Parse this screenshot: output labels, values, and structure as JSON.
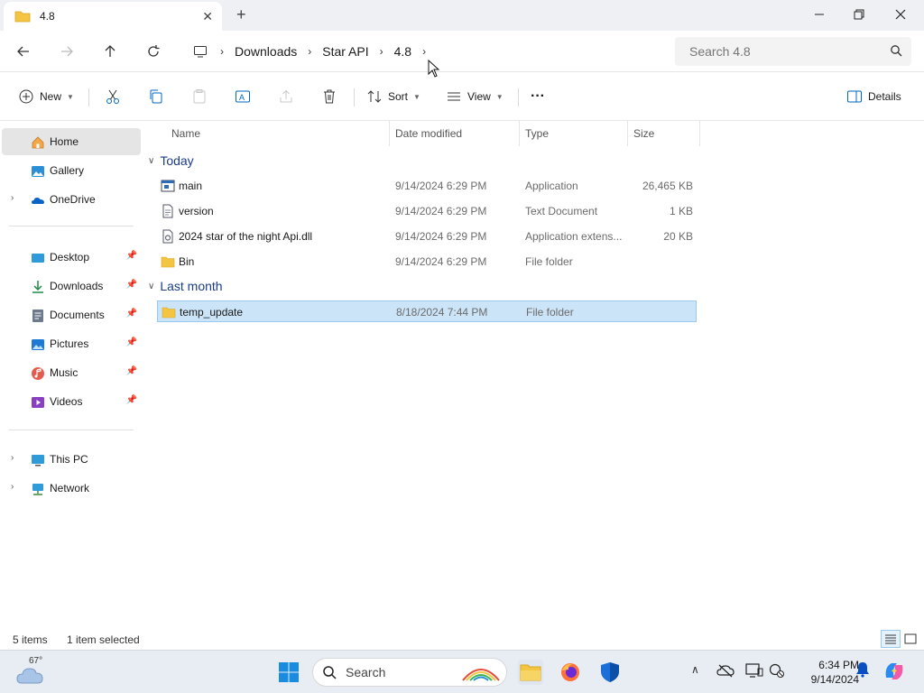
{
  "window": {
    "tab_title": "4.8",
    "new_tab": "+",
    "close_tab": "✕"
  },
  "address": {
    "crumbs": [
      "Downloads",
      "Star API",
      "4.8"
    ],
    "search_placeholder": "Search 4.8"
  },
  "commands": {
    "new": "New",
    "sort": "Sort",
    "view": "View",
    "more": "···",
    "details": "Details"
  },
  "sidebar": {
    "top": [
      {
        "label": "Home",
        "icon": "home-icon"
      },
      {
        "label": "Gallery",
        "icon": "gallery-icon"
      },
      {
        "label": "OneDrive",
        "icon": "onedrive-icon"
      }
    ],
    "quick": [
      {
        "label": "Desktop",
        "icon": "desktop-icon"
      },
      {
        "label": "Downloads",
        "icon": "downloads-icon"
      },
      {
        "label": "Documents",
        "icon": "documents-icon"
      },
      {
        "label": "Pictures",
        "icon": "pictures-icon"
      },
      {
        "label": "Music",
        "icon": "music-icon"
      },
      {
        "label": "Videos",
        "icon": "videos-icon"
      }
    ],
    "bottom": [
      {
        "label": "This PC",
        "icon": "this-pc-icon"
      },
      {
        "label": "Network",
        "icon": "network-icon"
      }
    ],
    "pin_glyph": "📌"
  },
  "columns": {
    "name": "Name",
    "date": "Date modified",
    "type": "Type",
    "size": "Size"
  },
  "groups": [
    {
      "label": "Today",
      "files": [
        {
          "name": "main",
          "date": "9/14/2024 6:29 PM",
          "type": "Application",
          "size": "26,465 KB",
          "icon": "application-icon"
        },
        {
          "name": "version",
          "date": "9/14/2024 6:29 PM",
          "type": "Text Document",
          "size": "1 KB",
          "icon": "text-document-icon"
        },
        {
          "name": "2024 star of the night Api.dll",
          "date": "9/14/2024 6:29 PM",
          "type": "Application extens...",
          "size": "20 KB",
          "icon": "dll-icon"
        },
        {
          "name": "Bin",
          "date": "9/14/2024 6:29 PM",
          "type": "File folder",
          "size": "",
          "icon": "folder-icon"
        }
      ]
    },
    {
      "label": "Last month",
      "files": [
        {
          "name": "temp_update",
          "date": "8/18/2024 7:44 PM",
          "type": "File folder",
          "size": "",
          "icon": "folder-icon",
          "selected": true
        }
      ]
    }
  ],
  "status": {
    "count": "5 items",
    "selected": "1 item selected"
  },
  "taskbar": {
    "temperature": "67°",
    "search_label": "Search",
    "time": "6:34 PM",
    "date": "9/14/2024"
  },
  "colors": {
    "selection_bg": "#cce4f7",
    "selection_border": "#99c9ef",
    "group_header": "#1b3c8a",
    "folder_yellow": "#f4c542",
    "accent_blue": "#0067c0"
  }
}
